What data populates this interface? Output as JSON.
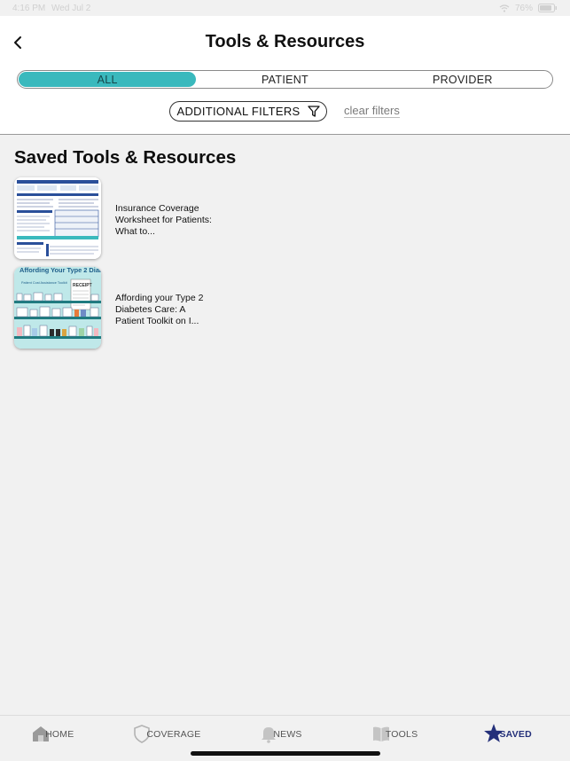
{
  "status_bar": {
    "time": "4:16 PM",
    "date": "Wed Jul 2",
    "battery": "76%",
    "wifi_icon": "wifi-icon",
    "battery_icon": "battery-icon"
  },
  "header": {
    "title": "Tools & Resources",
    "back_icon": "chevron-left-icon"
  },
  "segments": {
    "items": [
      {
        "label": "ALL",
        "active": true
      },
      {
        "label": "PATIENT",
        "active": false
      },
      {
        "label": "PROVIDER",
        "active": false
      }
    ],
    "accent_color": "#3ab9bd"
  },
  "filters": {
    "additional_label": "ADDITIONAL FILTERS",
    "filter_icon": "funnel-icon",
    "clear_label": "clear filters"
  },
  "saved": {
    "title": "Saved Tools & Resources",
    "items": [
      {
        "title": "Insurance Coverage Worksheet for Patients: What to...",
        "thumb_icon": "worksheet-thumbnail"
      },
      {
        "title": "Affording your Type 2 Diabetes Care: A Patient Toolkit on I...",
        "thumb_icon": "toolkit-thumbnail",
        "thumb_heading": "Affording Your Type 2 Diabetes Care",
        "thumb_subheading": "Patient Cost Assistance Toolkit",
        "thumb_receipt": "RECEIPT"
      }
    ]
  },
  "tabbar": {
    "tabs": [
      {
        "label": "HOME",
        "icon": "home-icon",
        "active": false
      },
      {
        "label": "COVERAGE",
        "icon": "shield-icon",
        "active": false
      },
      {
        "label": "NEWS",
        "icon": "bell-icon",
        "active": false
      },
      {
        "label": "TOOLS",
        "icon": "book-icon",
        "active": false
      },
      {
        "label": "SAVED",
        "icon": "star-icon",
        "active": true
      }
    ],
    "active_color": "#24307a"
  }
}
